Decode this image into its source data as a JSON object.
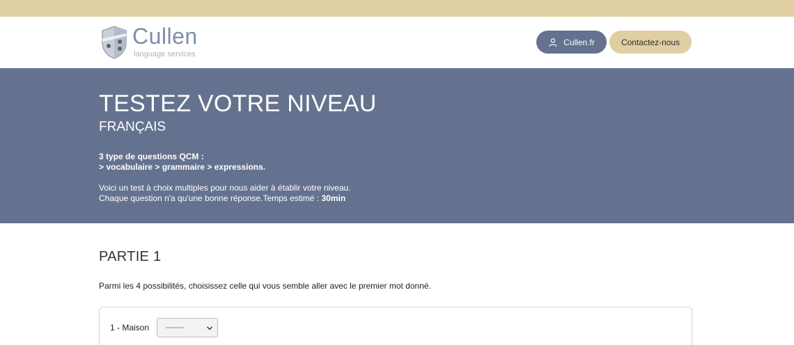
{
  "header": {
    "logo_name": "Cullen",
    "logo_sub": "language services",
    "cullen_button": "Cullen.fr",
    "contact_button": "Contactez-nous"
  },
  "banner": {
    "title": "TESTEZ VOTRE NIVEAU",
    "subtitle": "FRANÇAIS",
    "qcm_line1": "3 type de questions QCM :",
    "qcm_line2": "> vocabulaire > grammaire > expressions.",
    "desc_line1": "Voici un test à choix multiples pour nous aider à établir votre niveau.",
    "desc_line2": "Chaque question n'a qu'une bonne réponse.Temps estimé : ",
    "desc_time": "30min"
  },
  "section": {
    "title": "PARTIE 1",
    "instructions": "Parmi les 4 possibilités, choisissez celle qui vous semble aller avec le premier mot donné."
  },
  "questions": [
    {
      "label": "1 - Maison",
      "selected": "-------"
    }
  ],
  "icons": {
    "user": "user-icon",
    "shield": "shield-logo-icon",
    "chevron": "chevron-down-icon"
  },
  "colors": {
    "accent_gold": "#e0cfa3",
    "slate_blue": "#65728f"
  }
}
